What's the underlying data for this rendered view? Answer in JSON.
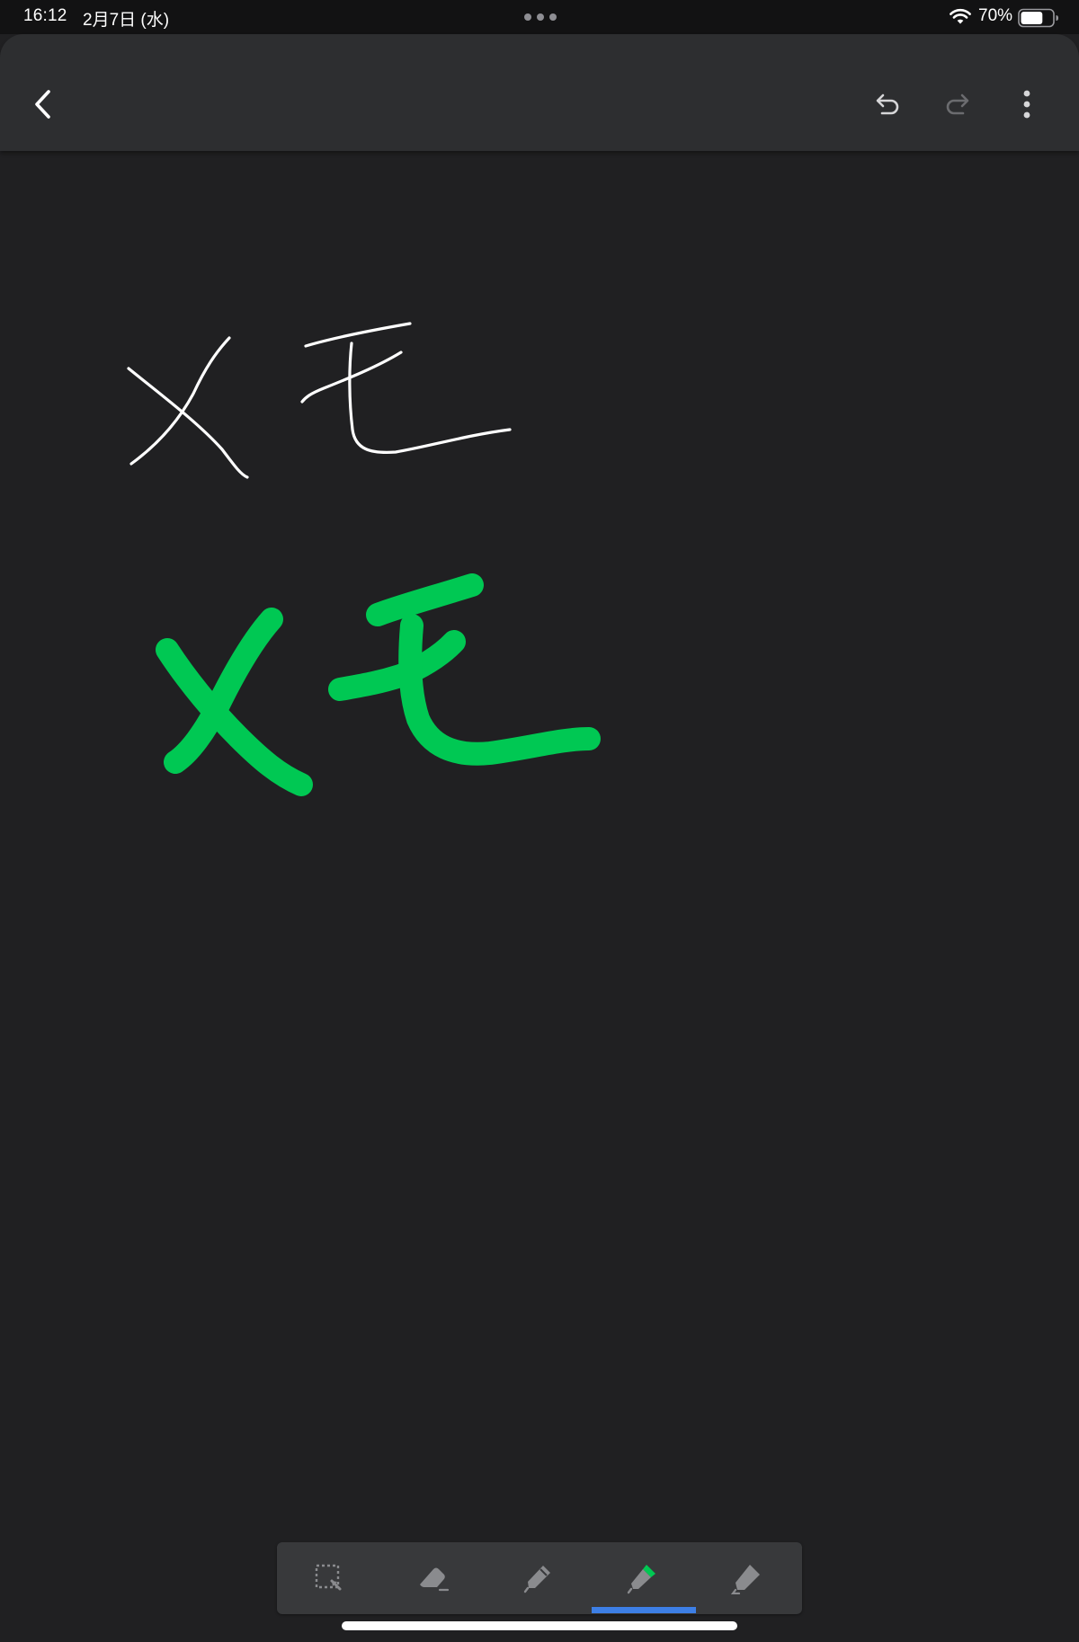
{
  "status_bar": {
    "time": "16:12",
    "date": "2月7日 (水)",
    "battery_percent": "70%",
    "battery_level": 0.7,
    "wifi_icon": "wifi-icon",
    "multitask_icon": "ellipsis-icon"
  },
  "toolbar": {
    "back_icon": "chevron-left-icon",
    "undo_icon": "undo-icon",
    "redo_icon": "redo-icon",
    "redo_enabled": false,
    "more_icon": "more-vertical-icon"
  },
  "canvas": {
    "background_color": "#202022",
    "strokes": [
      {
        "name": "white-handwriting-memo",
        "text_depicted": "メモ",
        "color": "#ffffff",
        "tool": "pen"
      },
      {
        "name": "green-handwriting-memo",
        "text_depicted": "メモ",
        "color": "#00c853",
        "tool": "marker"
      }
    ]
  },
  "tool_palette": {
    "tools": [
      {
        "id": "lasso",
        "icon": "lasso-select-icon"
      },
      {
        "id": "eraser",
        "icon": "eraser-icon"
      },
      {
        "id": "pen",
        "icon": "pen-icon"
      },
      {
        "id": "marker",
        "icon": "marker-icon",
        "tip_color": "#00c853"
      },
      {
        "id": "highlighter",
        "icon": "highlighter-icon"
      }
    ],
    "active_tool": "marker",
    "active_color": "#3d7fe6"
  }
}
